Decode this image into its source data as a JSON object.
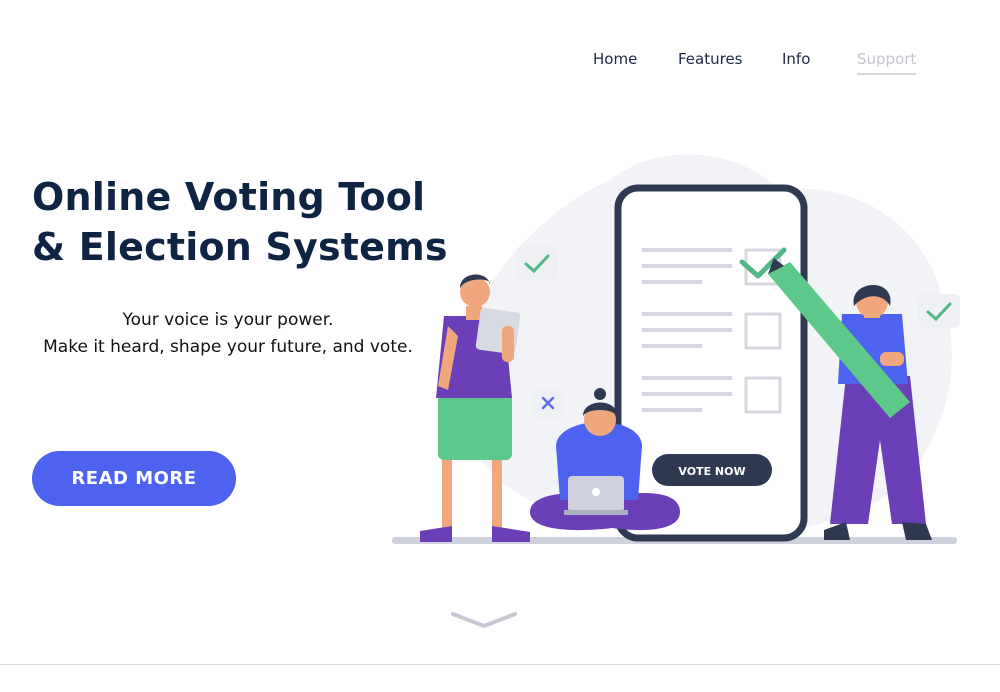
{
  "nav": {
    "items": [
      {
        "label": "Home"
      },
      {
        "label": "Features"
      },
      {
        "label": "Info"
      },
      {
        "label": "Support"
      }
    ]
  },
  "hero": {
    "title_line1": "Online Voting Tool",
    "title_line2": "& Election Systems",
    "subtitle_line1": "Your voice is your power.",
    "subtitle_line2": "Make it heard, shape your future, and vote.",
    "cta_label": "READ MORE"
  },
  "illustration": {
    "phone_button_label": "VOTE NOW",
    "ballot_options_checked": [
      true,
      false,
      false
    ]
  },
  "colors": {
    "brand_dark": "#0f2342",
    "cta_blue": "#4d63f0",
    "accent_green": "#5cc98a",
    "accent_purple": "#6b3fb8",
    "muted_nav": "#c3c6cf"
  },
  "icons": {
    "scroll": "chevron-down-icon"
  }
}
